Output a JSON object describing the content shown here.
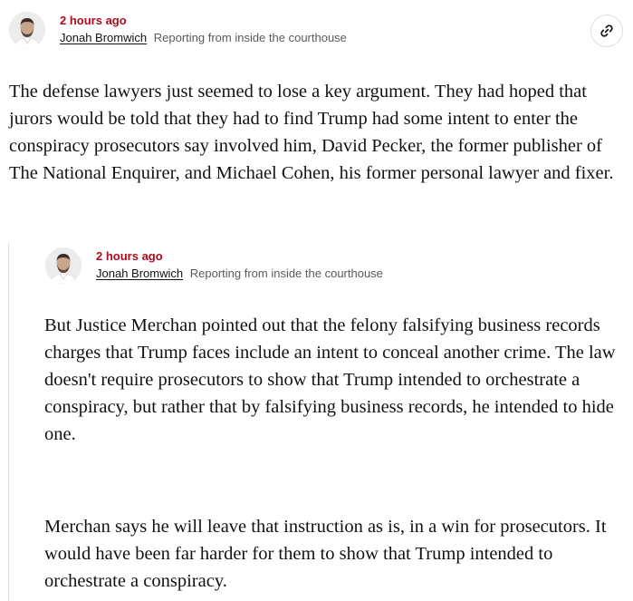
{
  "post": {
    "timestamp": "2 hours ago",
    "author": "Jonah Bromwich",
    "reporting_note": "Reporting from inside the courthouse",
    "paragraph": "The defense lawyers just seemed to lose a key argument. They had hoped that jurors would be told that they had to find Trump had some intent to enter the conspiracy prosecutors say involved him, David Pecker, the former publisher of The National Enquirer, and Michael Cohen, his former personal lawyer and fixer.",
    "link_icon": "link-icon"
  },
  "nested_post": {
    "timestamp": "2 hours ago",
    "author": "Jonah Bromwich",
    "reporting_note": "Reporting from inside the courthouse",
    "paragraphs": [
      "But Justice Merchan pointed out that the felony falsifying business records charges that Trump faces include an intent to conceal another crime. The law doesn't require prosecutors to show that Trump intended to orchestrate a conspiracy, but rather that by falsifying business records, he intended to hide one.",
      "Merchan says he will leave that instruction as is, in a win for prosecutors. It would have been far harder for them to show that Trump intended to orchestrate a conspiracy."
    ]
  },
  "colors": {
    "timestamp": "#b00b1b",
    "text": "#121212",
    "muted": "#5a5a5a",
    "rule": "#dcdcdc"
  }
}
